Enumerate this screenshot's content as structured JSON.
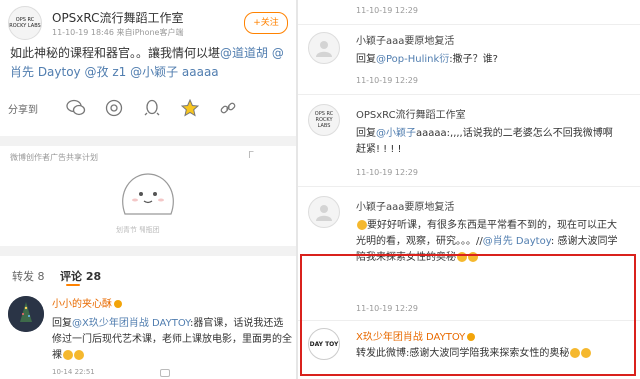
{
  "post": {
    "author": "OPSxRC流行舞蹈工作室",
    "time": "11-10-19 18:46",
    "source": "来自iPhone客户端",
    "follow_label": "+关注",
    "avatar_text": "OPS RC ROCKY LABS",
    "text_1": "如此神秘的课程和器官。。讓我情何以堪",
    "mention_1": "@道道胡",
    "mention_2": "@肖先 Daytoy",
    "mention_3": "@孜 z1",
    "mention_4": "@小颖子 aaaaa"
  },
  "share": {
    "label": "分享到"
  },
  "ad": {
    "label": "微博创作者广告共享计划",
    "close_glyph": "Γ",
    "caption": "划青节  퉤瓶团"
  },
  "tabs": {
    "forward": "转发 8",
    "comment": "评论 28"
  },
  "comment1": {
    "user": "小小的夹心酥",
    "mention": "@X玖少年团肖战 DAYTOY",
    "text_after": ":器官课，话说我还选修过一门后现代艺术课，老师上课放电影，里面男的全裸",
    "reply_prefix": "回复",
    "time": "10-14 22:51"
  },
  "right": {
    "r1": {
      "time": "11-10-19 12:29"
    },
    "r2": {
      "user": "小颖子aaa要原地复活",
      "prefix": "回复",
      "mention": "@Pop-Hulink衍",
      "text": ":撒子？谁?",
      "time": "11-10-19 12:29"
    },
    "r3": {
      "user": "OPSxRC流行舞蹈工作室",
      "prefix": "回复",
      "mention": "@小颖子",
      "text": "aaaaa:,,,,话说我的二老婆怎么不回我微博啊 赶紧! ! ! !",
      "time": "11-10-19 12:29"
    },
    "r4": {
      "user": "小颖子aaa要原地复活",
      "text": "要好好听课，有很多东西是平常看不到的，现在可以正大光明的看，观察，研究。。。//",
      "mention": "@肖先 Daytoy",
      "text2": ": 感谢大波同学陪我来探索女性的奥秘",
      "time": "11-10-19 12:29"
    },
    "r5": {
      "user": "X玖少年团肖战 DAYTOY",
      "avatar_text": "DAY TOY",
      "text": "转发此微博:感谢大波同学陪我来探索女性的奥秘"
    }
  },
  "colors": {
    "accent": "#ff8200",
    "link": "#507daf",
    "highlight": "#d9211c"
  }
}
